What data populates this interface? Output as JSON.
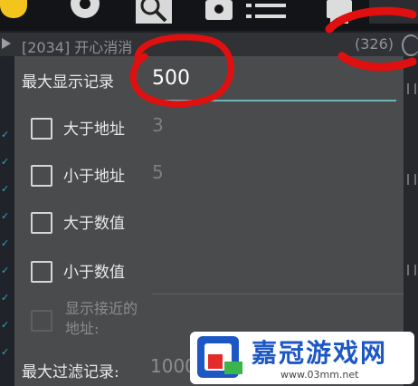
{
  "toolbar": {
    "icons": [
      "emoji-icon",
      "gear-icon",
      "search-icon",
      "camera-icon",
      "list-icon",
      "android-icon"
    ]
  },
  "process": {
    "name": "[2034] 开心消消",
    "count": "(326)"
  },
  "dialog": {
    "max_display_label": "最大显示记录",
    "max_display_value": "500",
    "options": [
      {
        "label": "大于地址",
        "value": "3"
      },
      {
        "label": "小于地址",
        "value": "5"
      },
      {
        "label": "大于数值",
        "value": ""
      },
      {
        "label": "小于数值",
        "value": ""
      }
    ],
    "show_near_label": "显示接近的地址:",
    "max_filter_label": "最大过滤记录:",
    "max_filter_value": "1000"
  },
  "watermark": {
    "title": "嘉冠游戏网",
    "url": "www.03mm.net"
  },
  "colors": {
    "dialog_bg": "#4a4b4d",
    "input_underline": "#6bb6b3",
    "annotation_red": "#e01010",
    "watermark_blue": "#1c57c4"
  }
}
